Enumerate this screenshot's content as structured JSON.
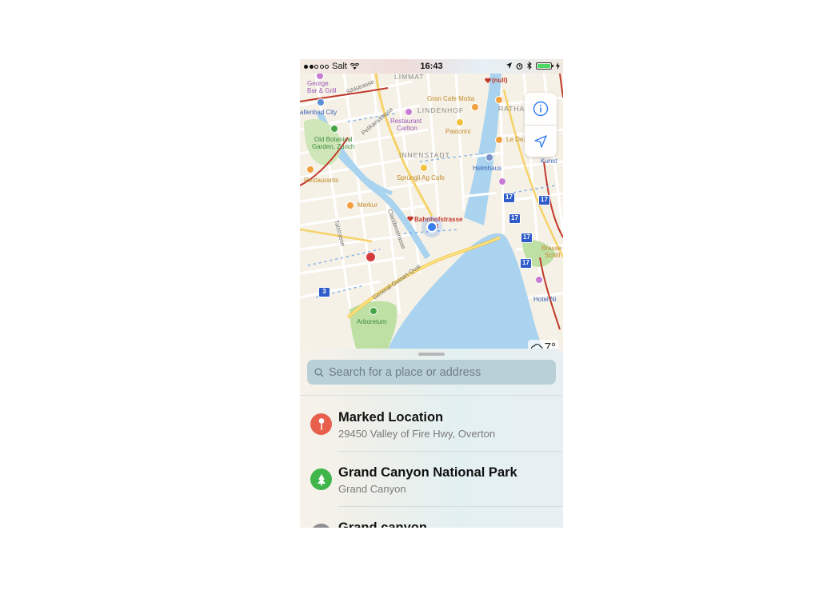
{
  "status_bar": {
    "carrier": "Salt",
    "time": "16:43",
    "signal_bars_filled": 2,
    "signal_bars_total": 5,
    "battery_level": 1.0,
    "colors": {
      "battery": "#4cd964"
    }
  },
  "map": {
    "labels": {
      "limmat": "LIMMAT",
      "george": "George",
      "george2": "Bar & Grill",
      "sihlstrasse": "Sihlstrasse",
      "hallenbad": "allenbad City",
      "pelikanstrasse": "Pelikanstrasse",
      "lindenhof": "LINDENHOF",
      "orange_cafe": "Gran Cafe Motta",
      "null_label": "(null)",
      "rathaus": "RATHA",
      "restaurant_carlton": "Restaurant",
      "restaurant_carlton2": "Carlton",
      "pastorini": "Pastorini",
      "botanical": "Old Botanical",
      "botanical2": "Garden, Zurich",
      "le_dez": "Le Dez",
      "innenstadt": "INNENSTADT",
      "helmhaus": "Helmhaus",
      "kunst": "Kunst",
      "restaurants": "Restaurants",
      "spruengli": "Sprüngli Ag Cafe",
      "merkur": "Merkur",
      "bahnhofstrasse": "Bahnhofstrasse",
      "bahnhofstrasse_num": "3",
      "talstrasse": "Talstrasse",
      "claridenstrasse": "Claridenstrasse",
      "brasse": "Brasse",
      "schill": "Schill",
      "general_guisan": "General-Guisan-Quai",
      "hotel_ni": "Hotel Ni",
      "arboretum": "Arboretum"
    },
    "route_badges": [
      "17",
      "17",
      "17",
      "17",
      "17",
      "3"
    ],
    "controls": {
      "info_icon": "info-icon",
      "location_icon": "location-arrow-icon"
    },
    "weather": {
      "icon": "cloud-icon",
      "temperature": "7°"
    },
    "colors": {
      "water": "#a9d3ef",
      "park": "#bfe0a5",
      "user_location": "#3a7ff0"
    }
  },
  "search": {
    "placeholder": "Search for a place or address",
    "icon": "search-icon"
  },
  "results": [
    {
      "title": "Marked Location",
      "subtitle": "29450 Valley of Fire Hwy, Overton",
      "icon": "pin-icon",
      "color": "#e8604c"
    },
    {
      "title": "Grand Canyon National Park",
      "subtitle": "Grand Canyon",
      "icon": "tree-icon",
      "color": "#3fb54a"
    },
    {
      "title": "Grand canyon",
      "subtitle": "",
      "icon": "search-result-icon",
      "color": "#8e8e93"
    }
  ]
}
